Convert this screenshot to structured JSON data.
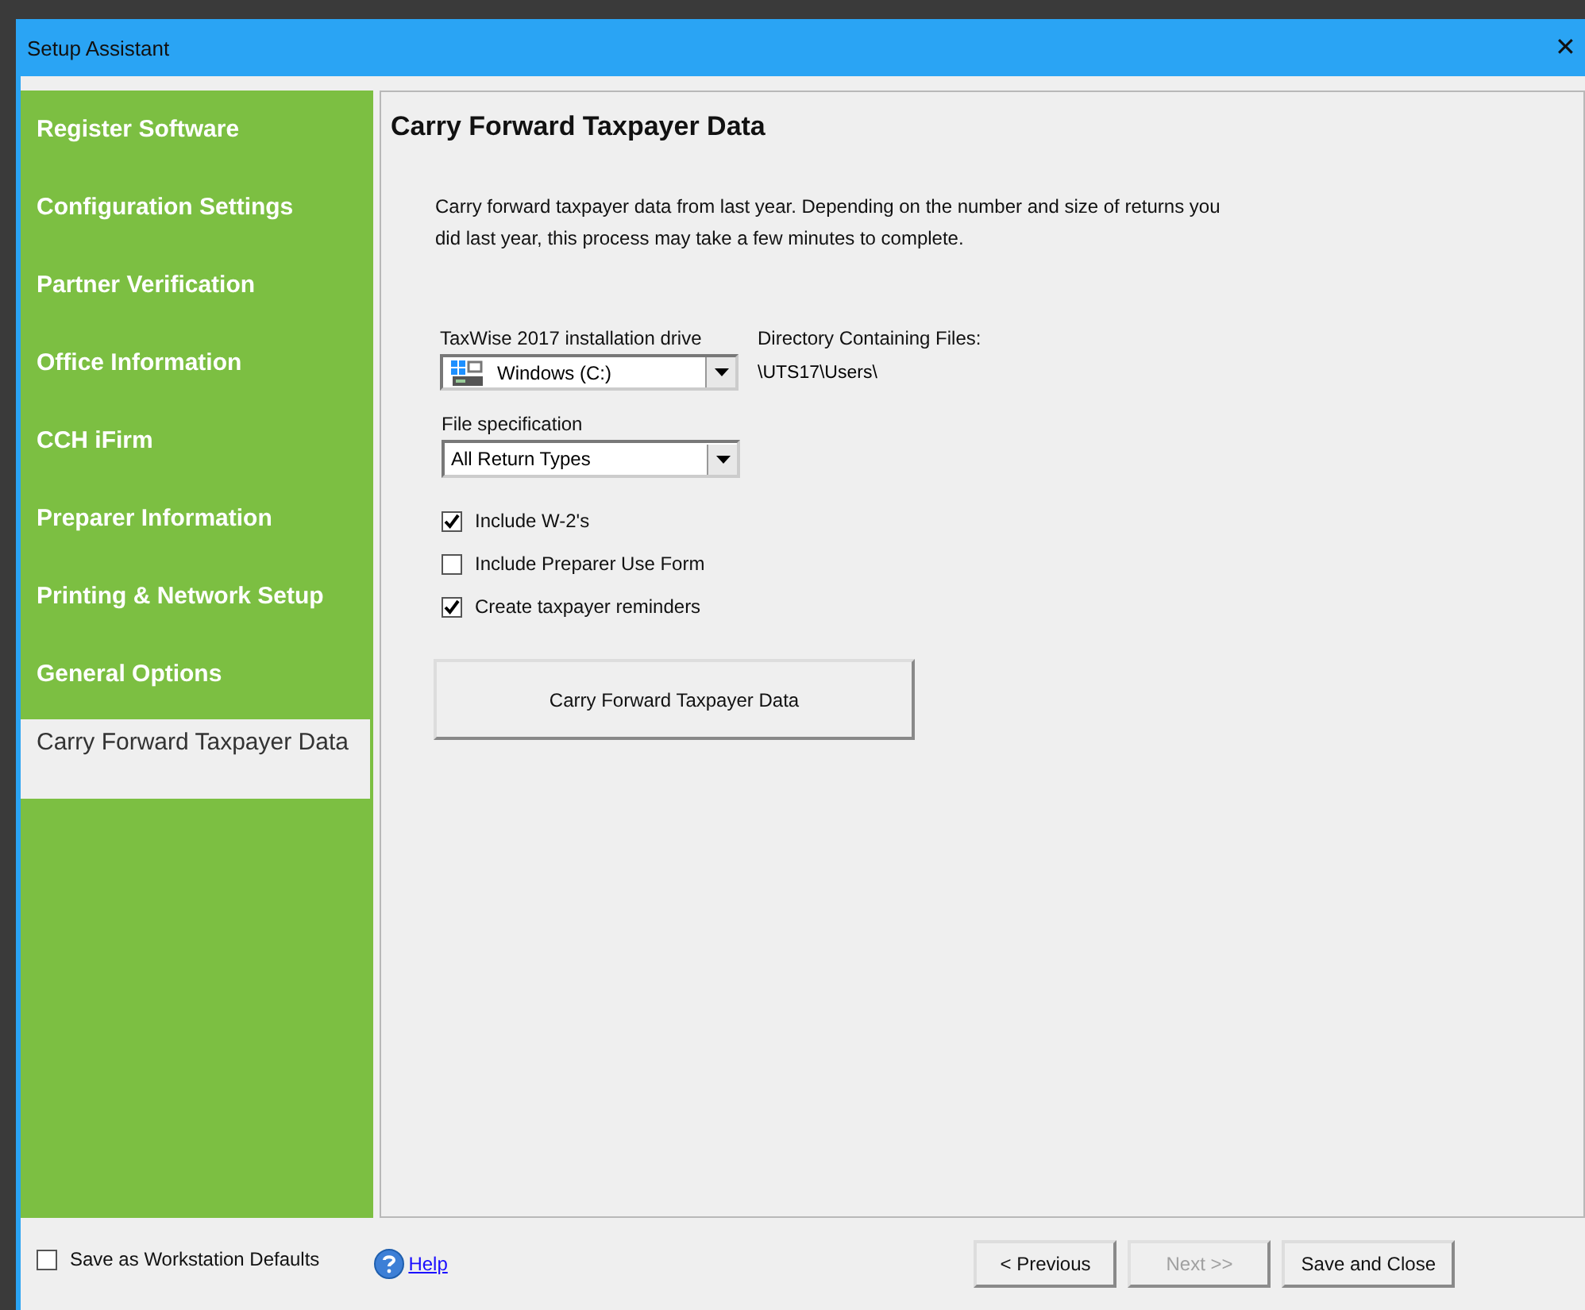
{
  "window": {
    "title": "Setup Assistant",
    "close": "✕"
  },
  "sidebar": {
    "items": [
      {
        "label": "Register Software",
        "selected": false
      },
      {
        "label": "Configuration Settings",
        "selected": false
      },
      {
        "label": "Partner Verification",
        "selected": false
      },
      {
        "label": "Office Information",
        "selected": false
      },
      {
        "label": "CCH iFirm",
        "selected": false
      },
      {
        "label": "Preparer Information",
        "selected": false
      },
      {
        "label": "Printing & Network Setup",
        "selected": false
      },
      {
        "label": "General Options",
        "selected": false
      },
      {
        "label": "Carry Forward Taxpayer Data",
        "selected": true
      }
    ]
  },
  "main": {
    "heading": "Carry Forward Taxpayer Data",
    "description": "Carry forward taxpayer data from last year.  Depending on the number and size of returns you did last year, this process may take a few minutes to complete.",
    "drive": {
      "label": "TaxWise 2017 installation drive",
      "value": "Windows (C:)"
    },
    "directory": {
      "label": "Directory Containing Files:",
      "value": "\\UTS17\\Users\\"
    },
    "file_spec": {
      "label": "File specification",
      "value": "All Return Types"
    },
    "options": [
      {
        "label": "Include W-2's",
        "checked": true
      },
      {
        "label": "Include Preparer Use Form",
        "checked": false
      },
      {
        "label": "Create taxpayer reminders",
        "checked": true
      }
    ],
    "action_button": "Carry Forward Taxpayer Data"
  },
  "footer": {
    "workstation_defaults": {
      "label": "Save as Workstation Defaults",
      "checked": false
    },
    "help": "Help",
    "buttons": [
      {
        "label": "< Previous",
        "disabled": false
      },
      {
        "label": "Next >>",
        "disabled": true
      },
      {
        "label": "Save and Close",
        "disabled": false
      }
    ]
  }
}
